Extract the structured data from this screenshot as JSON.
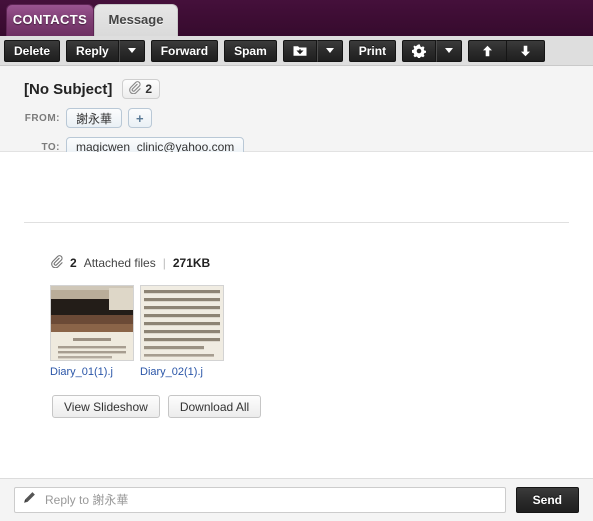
{
  "tabs": [
    {
      "label": "CONTACTS",
      "active": false,
      "name": "tab-contacts"
    },
    {
      "label": "Message",
      "active": true,
      "name": "tab-message"
    }
  ],
  "toolbar": {
    "delete_label": "Delete",
    "reply_label": "Reply",
    "reply_caret_icon": "chevron-down-icon",
    "forward_label": "Forward",
    "spam_label": "Spam",
    "move_icon": "folder-move-icon",
    "move_caret_icon": "chevron-down-icon",
    "print_label": "Print",
    "settings_icon": "gear-icon",
    "settings_caret_icon": "chevron-down-icon",
    "prev_icon": "arrow-up-icon",
    "next_icon": "arrow-down-icon"
  },
  "message": {
    "subject": "[No Subject]",
    "attachment_badge_count": "2",
    "attachment_badge_icon": "paperclip-icon",
    "from_label": "FROM:",
    "from_name": "謝永華",
    "add_contact_label": "+",
    "to_label": "TO:",
    "to_address": "magicwen_clinic@yahoo.com",
    "body_text": ""
  },
  "attachments": {
    "summary_icon": "paperclip-icon",
    "count_text": "2",
    "count_label": "Attached files",
    "separator": "|",
    "total_size": "271KB",
    "files": [
      {
        "name": "Diary_01(1).j",
        "thumb": "photo-dark-wood"
      },
      {
        "name": "Diary_02(1).j",
        "thumb": "scanned-document"
      }
    ],
    "view_slideshow_label": "View Slideshow",
    "download_all_label": "Download All"
  },
  "reply": {
    "pencil_icon": "pencil-icon",
    "placeholder": "Reply to 謝永華",
    "value": "",
    "send_label": "Send"
  },
  "colors": {
    "header_purple": "#3a0b31",
    "tab_active_bg": "#dedede",
    "toolbar_bg": "#dedede",
    "button_dark": "#2b2b2b",
    "link_blue": "#2b56a8"
  }
}
